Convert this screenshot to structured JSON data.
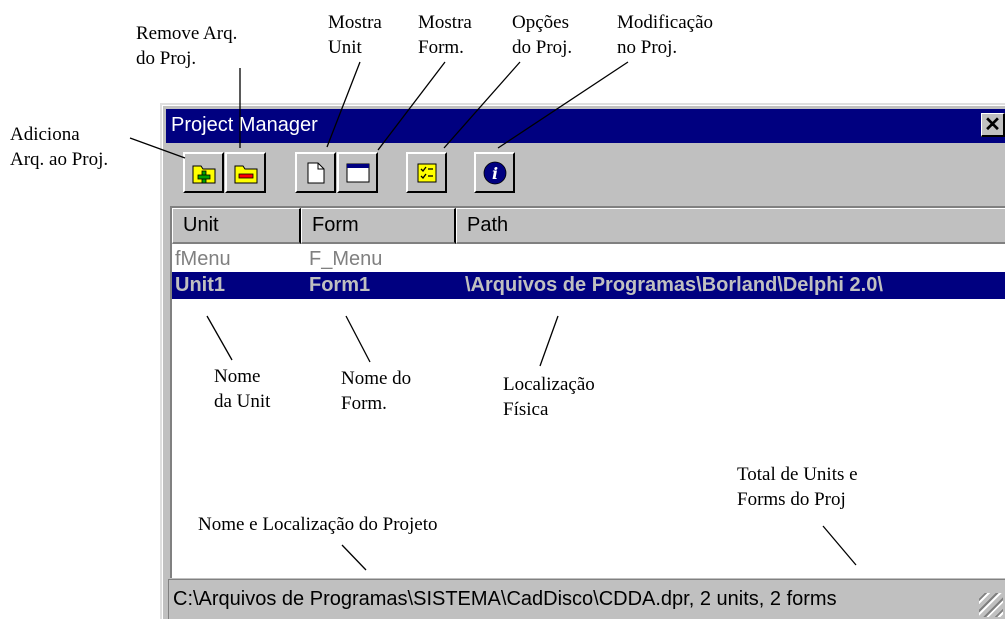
{
  "window": {
    "title": "Project Manager",
    "close_label": "✕"
  },
  "columns": [
    "Unit",
    "Form",
    "Path"
  ],
  "rows": [
    {
      "unit": "fMenu",
      "form": "F_Menu",
      "path": ""
    },
    {
      "unit": "Unit1",
      "form": "Form1",
      "path": "\\Arquivos de Programas\\Borland\\Delphi 2.0\\"
    }
  ],
  "selected_row": 1,
  "status_text": "C:\\Arquivos de Programas\\SISTEMA\\CadDisco\\CDDA.dpr, 2 units, 2 forms",
  "toolbar": [
    {
      "name": "add-file-button",
      "icon": "add-icon"
    },
    {
      "name": "remove-file-button",
      "icon": "remove-icon"
    },
    {
      "name": "view-unit-button",
      "icon": "page-icon"
    },
    {
      "name": "view-form-button",
      "icon": "form-window-icon"
    },
    {
      "name": "project-options-button",
      "icon": "checklist-icon"
    },
    {
      "name": "update-button",
      "icon": "info-icon"
    }
  ],
  "annotations": {
    "adiciona": [
      "Adiciona",
      "Arq. ao Proj."
    ],
    "remove": [
      "Remove Arq.",
      "do Proj."
    ],
    "mostra_unit": [
      "Mostra",
      "Unit"
    ],
    "mostra_form": [
      "Mostra",
      "Form."
    ],
    "opcoes": [
      "Opções",
      "do Proj."
    ],
    "modificacao": [
      "Modificação",
      "no Proj."
    ],
    "nome_unit": [
      "Nome",
      "da Unit"
    ],
    "nome_form": [
      "Nome do",
      "Form."
    ],
    "localizacao": [
      "Localização",
      "Física"
    ],
    "nome_projeto": [
      "Nome e Localização do Projeto"
    ],
    "total": [
      "Total de Units e",
      "Forms do Proj"
    ]
  },
  "colors": {
    "title_bg": "#000080",
    "selection_bg": "#000080",
    "face": "#c0c0c0",
    "icon_yellow": "#ffff00",
    "add_green": "#00a000",
    "remove_red": "#ff0000"
  }
}
